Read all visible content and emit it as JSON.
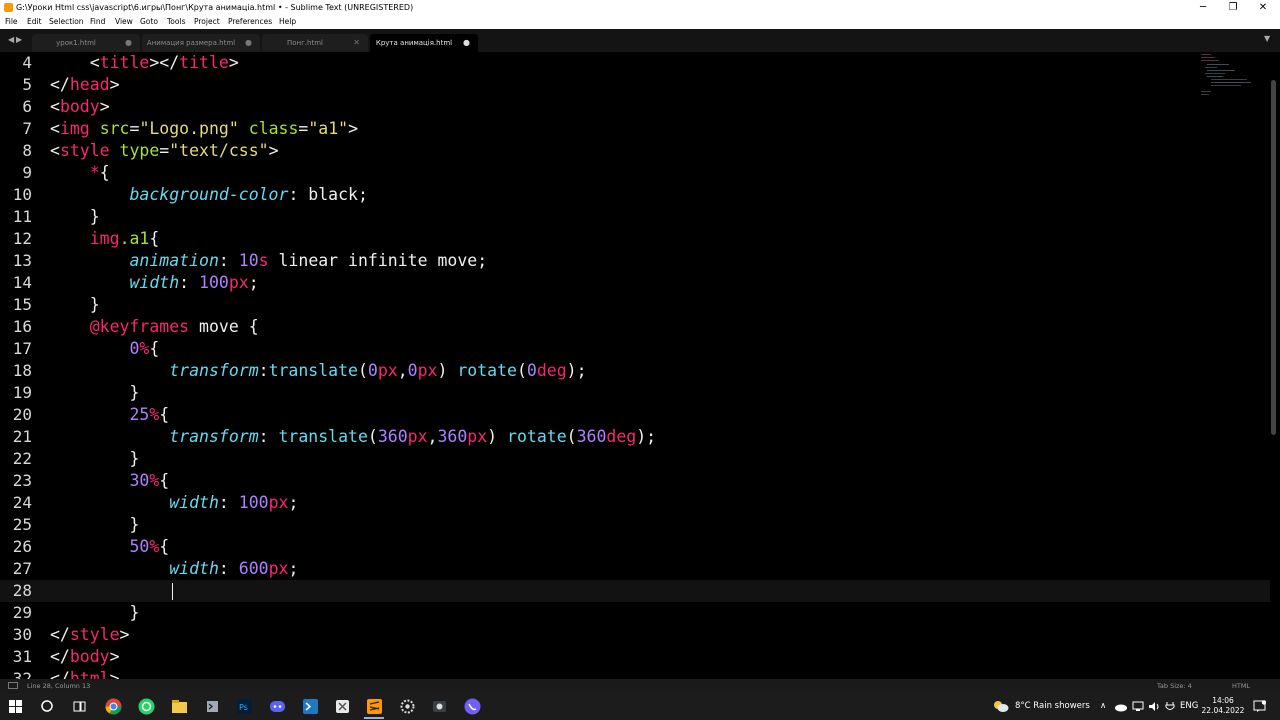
{
  "window": {
    "title": "G:\\Уроки Html css\\javascript\\6.игры\\Понг\\Крута анимаціа.html • - Sublime Text (UNREGISTERED)",
    "controls": {
      "minimize": "─",
      "maximize": "❐",
      "close": "✕"
    }
  },
  "menu": [
    "File",
    "Edit",
    "Selection",
    "Find",
    "View",
    "Goto",
    "Tools",
    "Project",
    "Preferences",
    "Help"
  ],
  "tabs": {
    "nav_prev": "◀",
    "nav_next": "▶",
    "items": [
      {
        "label": "урок1.html",
        "indicator": "●"
      },
      {
        "label": "Анимация размера.html",
        "indicator": "●"
      },
      {
        "label": "Понг.html",
        "indicator": "✕"
      },
      {
        "label": "Крута анимація.html",
        "indicator": "●"
      }
    ],
    "dropdown": "▼"
  },
  "editor": {
    "line_numbers": [
      "4",
      "5",
      "6",
      "7",
      "8",
      "9",
      "10",
      "11",
      "12",
      "13",
      "14",
      "15",
      "16",
      "17",
      "18",
      "19",
      "20",
      "21",
      "22",
      "23",
      "24",
      "25",
      "26",
      "27",
      "28",
      "29",
      "30",
      "31",
      "32"
    ],
    "line_28_text": ""
  },
  "status": {
    "position": "Line 28, Column 13",
    "tab_size": "Tab Size: 4",
    "syntax": "HTML"
  },
  "taskbar": {
    "weather": "8°C  Rain showers",
    "caret": "∧",
    "language": "ENG",
    "time": "14:06",
    "date": "22.04.2022"
  }
}
